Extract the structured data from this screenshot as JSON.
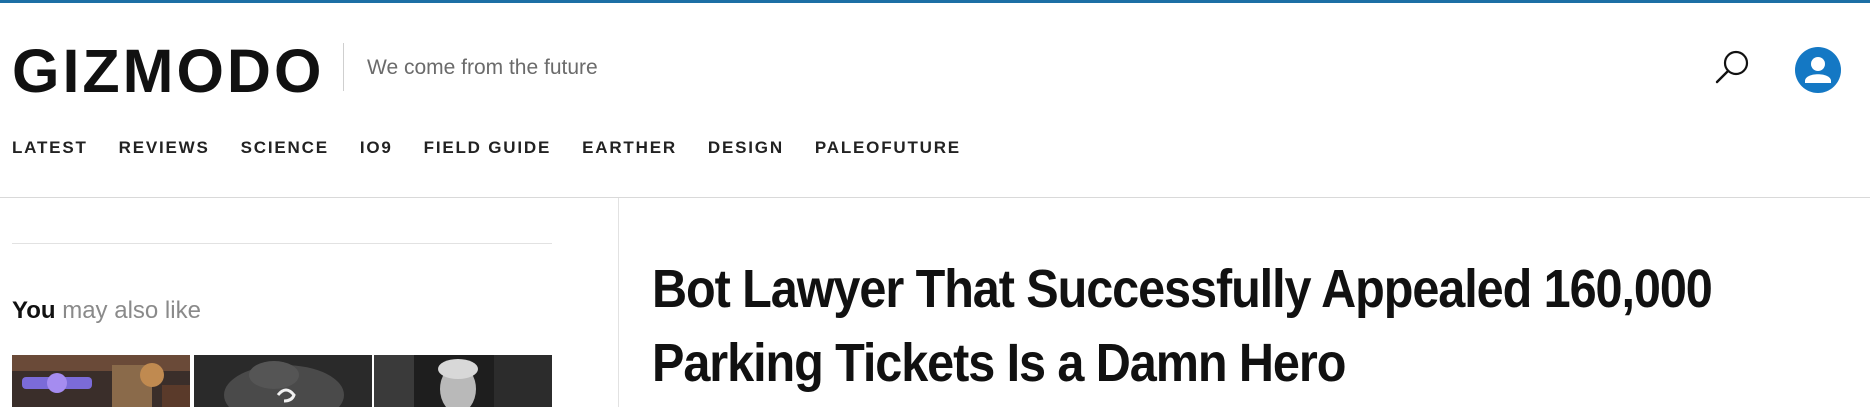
{
  "header": {
    "logo": "GIZMODO",
    "tagline": "We come from the future",
    "search_icon": "search-icon",
    "user_icon": "user-icon",
    "accent_color": "#1478c4",
    "top_bar_color": "#1d6fa5"
  },
  "nav": {
    "items": [
      {
        "label": "LATEST"
      },
      {
        "label": "REVIEWS"
      },
      {
        "label": "SCIENCE"
      },
      {
        "label": "IO9"
      },
      {
        "label": "FIELD GUIDE"
      },
      {
        "label": "EARTHER"
      },
      {
        "label": "DESIGN"
      },
      {
        "label": "PALEOFUTURE"
      }
    ]
  },
  "sidebar": {
    "heading_bold": "You",
    "heading_light": "may also like"
  },
  "article": {
    "headline_line1": "Bot Lawyer That Successfully Appealed 160,000",
    "headline_line2": "Parking Tickets Is a Damn Hero"
  }
}
